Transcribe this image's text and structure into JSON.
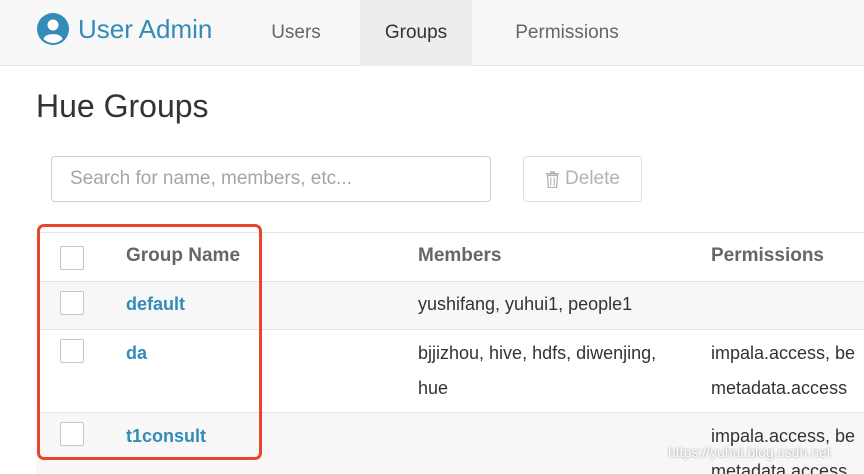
{
  "brand": {
    "title": "User Admin",
    "icon": "user-circle-icon",
    "color": "#338bb8"
  },
  "nav": {
    "tabs": [
      {
        "label": "Users",
        "active": false
      },
      {
        "label": "Groups",
        "active": true
      },
      {
        "label": "Permissions",
        "active": false
      }
    ]
  },
  "page": {
    "title": "Hue Groups"
  },
  "actions": {
    "search_placeholder": "Search for name, members, etc...",
    "delete_label": "Delete",
    "delete_icon": "trash-icon"
  },
  "table": {
    "columns": [
      "Group Name",
      "Members",
      "Permissions"
    ],
    "rows": [
      {
        "name": "default",
        "members": [
          "yushifang, yuhui1, people1"
        ],
        "permissions": []
      },
      {
        "name": "da",
        "members": [
          "bjjizhou, hive, hdfs, diwenjing,",
          "hue"
        ],
        "permissions": [
          "impala.access, be",
          "metadata.access"
        ]
      },
      {
        "name": "t1consult",
        "members": [],
        "permissions": [
          "impala.access, be",
          "metadata.access"
        ]
      }
    ]
  },
  "annotation": {
    "highlight_color": "#e8452c"
  },
  "watermark": "https://yuhui.blog.csdn.net"
}
